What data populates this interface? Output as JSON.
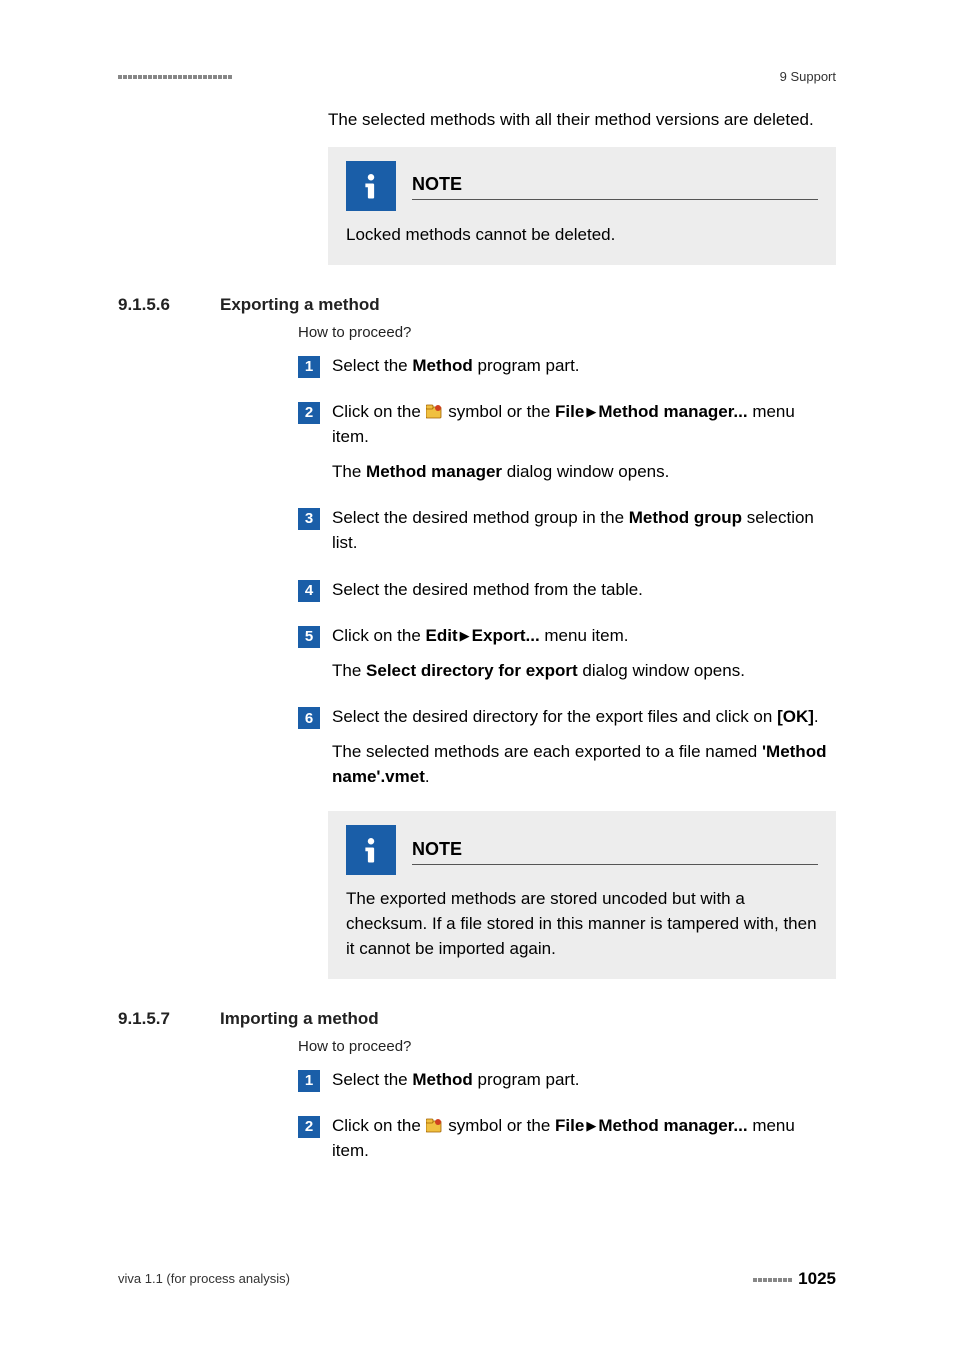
{
  "header": {
    "chapter": "9 Support"
  },
  "intro": "The selected methods with all their method versions are deleted.",
  "note1": {
    "title": "NOTE",
    "body": "Locked methods cannot be deleted."
  },
  "section1": {
    "num": "9.1.5.6",
    "title": "Exporting a method",
    "howto": "How to proceed?",
    "s1": {
      "t1": "Select the ",
      "method": "Method",
      "t2": " program part."
    },
    "s2": {
      "pre": "Click on the ",
      "mid": " symbol or the ",
      "file": "File",
      "mm": "Method manager...",
      "post": " menu item.",
      "result_pre": "The ",
      "mm2": "Method manager",
      "result_post": " dialog window opens."
    },
    "s3": {
      "pre": "Select the desired method group in the ",
      "mg": "Method group",
      "post": " selection list."
    },
    "s4": "Select the desired method from the table.",
    "s5": {
      "pre": "Click on the ",
      "edit": "Edit",
      "export": "Export...",
      "post": " menu item.",
      "res_pre": "The ",
      "dlg": "Select directory for export",
      "res_post": " dialog window opens."
    },
    "s6": {
      "pre": "Select the desired directory for the export files and click on ",
      "ok": "[OK]",
      "post": ".",
      "res_pre": "The selected methods are each exported to a file named ",
      "fname": "'Method name'.vmet",
      "res_post": "."
    }
  },
  "note2": {
    "title": "NOTE",
    "body": "The exported methods are stored uncoded but with a checksum. If a file stored in this manner is tampered with, then it cannot be imported again."
  },
  "section2": {
    "num": "9.1.5.7",
    "title": "Importing a method",
    "howto": "How to proceed?",
    "s1": {
      "t1": "Select the ",
      "method": "Method",
      "t2": " program part."
    },
    "s2": {
      "pre": "Click on the ",
      "mid": " symbol or the ",
      "file": "File",
      "mm": "Method manager...",
      "post": " menu item."
    }
  },
  "footer": {
    "left": "viva 1.1 (for process analysis)",
    "page": "1025"
  },
  "icons": {
    "info": "info-icon",
    "folder": "folder-icon"
  }
}
